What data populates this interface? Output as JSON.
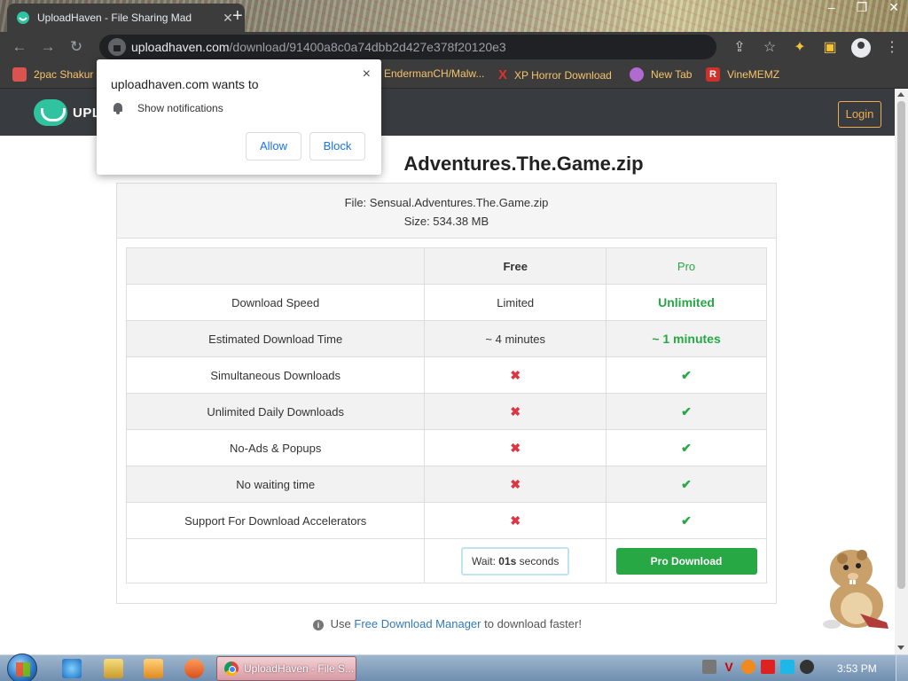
{
  "browser": {
    "tab_title": "UploadHaven - File Sharing Mad",
    "url_domain": "uploadhaven.com",
    "url_path": "/download/91400a8c0a74dbb2d427e378f20120e3",
    "bookmarks": [
      {
        "label": "2pac Shakur -",
        "icon_color": "#d9534f"
      },
      {
        "label": "EndermanCH/Malw...",
        "icon_color": ""
      },
      {
        "label": "XP Horror Download",
        "icon_color": "#e03030"
      },
      {
        "label": "New Tab",
        "icon_color": "#b06ad0"
      },
      {
        "label": "VineMEMZ",
        "icon_color": "#d0302a"
      }
    ]
  },
  "notification": {
    "title": "uploadhaven.com wants to",
    "message": "Show notifications",
    "allow_label": "Allow",
    "block_label": "Block",
    "close_glyph": "×"
  },
  "site": {
    "brand": "UPL",
    "login_label": "Login",
    "file_title": "Adventures.The.Game.zip",
    "file_line": "File: Sensual.Adventures.The.Game.zip",
    "size_line": "Size: 534.38 MB"
  },
  "comparison": {
    "headers": {
      "feature": "",
      "free": "Free",
      "pro": "Pro"
    },
    "rows": [
      {
        "feature": "Download Speed",
        "free": "Limited",
        "pro": "Unlimited"
      },
      {
        "feature": "Estimated Download Time",
        "free": "~ 4 minutes",
        "pro": "~ 1 minutes"
      },
      {
        "feature": "Simultaneous Downloads",
        "free": "✖",
        "pro": "✔"
      },
      {
        "feature": "Unlimited Daily Downloads",
        "free": "✖",
        "pro": "✔"
      },
      {
        "feature": "No-Ads & Popups",
        "free": "✖",
        "pro": "✔"
      },
      {
        "feature": "No waiting time",
        "free": "✖",
        "pro": "✔"
      },
      {
        "feature": "Support For Download Accelerators",
        "free": "✖",
        "pro": "✔"
      }
    ],
    "wait_prefix": "Wait:",
    "wait_value": "01s",
    "wait_suffix": "seconds",
    "pro_download_label": "Pro Download"
  },
  "footer": {
    "pre": "Use",
    "link": "Free Download Manager",
    "post": "to download faster!"
  },
  "taskbar": {
    "task_label": "UploadHaven - File S...",
    "clock": "3:53 PM"
  },
  "colors": {
    "accent_green": "#28a745",
    "cross_red": "#dc3545",
    "login_orange": "#f0ad4e",
    "link_blue": "#337ab7",
    "nav_dark": "#383b3f"
  }
}
